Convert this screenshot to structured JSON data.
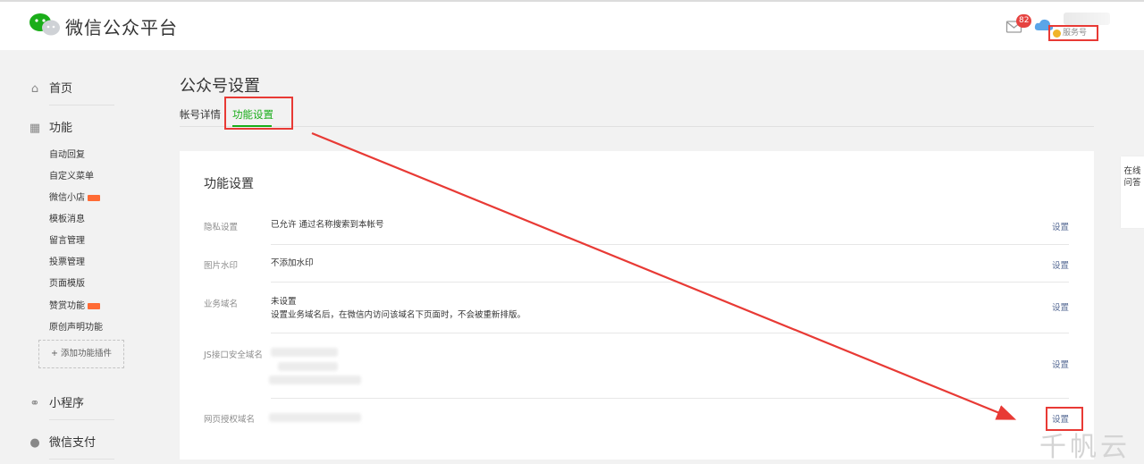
{
  "header": {
    "logo_text": "微信公众平台",
    "mail_badge_count": "82",
    "account_type_label": "服务号"
  },
  "sidebar": {
    "home": "首页",
    "features": "功能",
    "feature_items": [
      "自动回复",
      "自定义菜单",
      "微信小店",
      "模板消息",
      "留言管理",
      "投票管理",
      "页面模版",
      "赞赏功能",
      "原创声明功能"
    ],
    "add_plugin": "添加功能插件",
    "mini_program": "小程序",
    "wechat_pay": "微信支付"
  },
  "main": {
    "title": "公众号设置",
    "tabs": [
      "帐号详情",
      "功能设置"
    ],
    "card": {
      "title": "功能设置",
      "rows": [
        {
          "label": "隐私设置",
          "value": "已允许 通过名称搜索到本帐号",
          "action": "设置"
        },
        {
          "label": "图片水印",
          "value": "不添加水印",
          "action": "设置"
        },
        {
          "label": "业务域名",
          "value": "未设置",
          "value2": "设置业务域名后，在微信内访问该域名下页面时，不会被重新排版。",
          "action": "设置"
        },
        {
          "label": "JS接口安全域名",
          "value": "",
          "action": "设置"
        },
        {
          "label": "网页授权域名",
          "value": "",
          "action": "设置"
        }
      ]
    }
  },
  "floating": {
    "online_qa": "在线问答"
  },
  "watermark": "千帆云",
  "colors": {
    "accent_green": "#1aad19",
    "link_blue": "#576b95",
    "annotation_red": "#e83a35"
  }
}
